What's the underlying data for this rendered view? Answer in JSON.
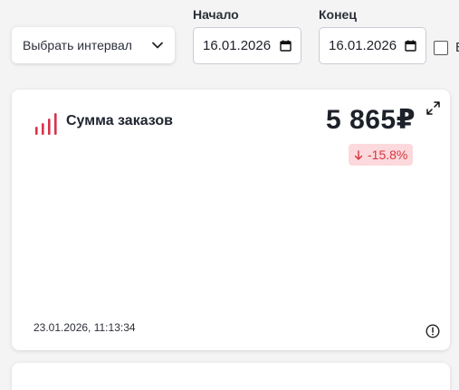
{
  "toolbar": {
    "interval_select": {
      "label": "Выбрать интервал",
      "icon": "chevron-down-icon"
    },
    "start": {
      "label": "Начало",
      "value": "16.01.2026",
      "icon": "calendar-icon"
    },
    "end": {
      "label": "Конец",
      "value": "16.01.2026",
      "icon": "calendar-icon"
    },
    "checkbox": {
      "checked": false,
      "label": "В"
    }
  },
  "card": {
    "icon": "bar-signal-icon",
    "title": "Сумма заказов",
    "value": "5 865₽",
    "delta": {
      "text": "-15.8%",
      "direction": "down",
      "icon": "arrow-down-icon"
    },
    "timestamp": "23.01.2026, 11:13:34",
    "expand_icon": "expand-icon",
    "info_icon": "info-icon"
  },
  "colors": {
    "accent": "#d9343f",
    "badge_bg": "#fcd9dc",
    "background": "#f4f4f5",
    "card": "#ffffff"
  }
}
